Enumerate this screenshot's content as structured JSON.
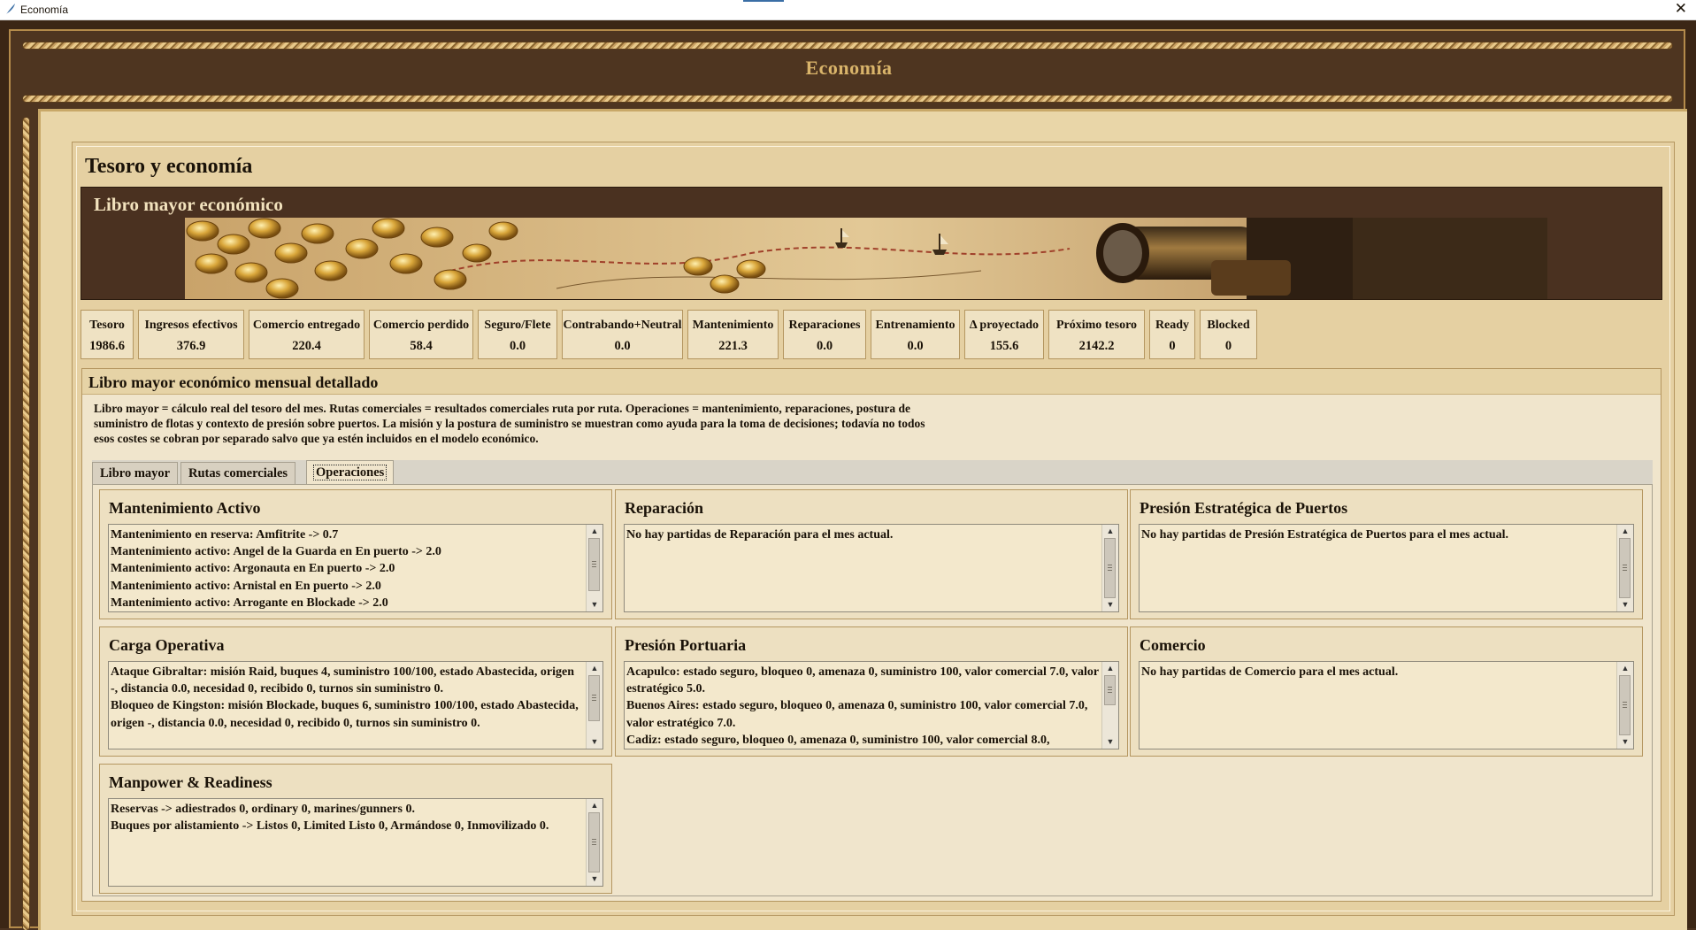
{
  "window": {
    "title": "Economía",
    "close_glyph": "✕"
  },
  "header": {
    "title": "Economía"
  },
  "section": {
    "title": "Tesoro y economía"
  },
  "banner": {
    "title": "Libro mayor económico"
  },
  "stats": [
    {
      "label": "Tesoro",
      "value": "1986.6"
    },
    {
      "label": "Ingresos efectivos",
      "value": "376.9"
    },
    {
      "label": "Comercio entregado",
      "value": "220.4"
    },
    {
      "label": "Comercio perdido",
      "value": "58.4"
    },
    {
      "label": "Seguro/Flete",
      "value": "0.0"
    },
    {
      "label": "Contrabando+Neutral",
      "value": "0.0"
    },
    {
      "label": "Mantenimiento",
      "value": "221.3"
    },
    {
      "label": "Reparaciones",
      "value": "0.0"
    },
    {
      "label": "Entrenamiento",
      "value": "0.0"
    },
    {
      "label": "Δ proyectado",
      "value": "155.6"
    },
    {
      "label": "Próximo tesoro",
      "value": "2142.2"
    },
    {
      "label": "Ready",
      "value": "0"
    },
    {
      "label": "Blocked",
      "value": "0"
    }
  ],
  "ledger": {
    "title": "Libro mayor económico mensual detallado",
    "description": [
      "Libro mayor = cálculo real del tesoro del mes. Rutas comerciales = resultados comerciales ruta por ruta. Operaciones = mantenimiento, reparaciones, postura de",
      "suministro de flotas y contexto de presión sobre puertos. La misión y la postura de suministro se muestran como ayuda para la toma de decisiones; todavía no todos",
      "esos costes se cobran por separado salvo que ya estén incluidos en el modelo económico."
    ]
  },
  "tabs": [
    {
      "label": "Libro mayor",
      "active": false
    },
    {
      "label": "Rutas comerciales",
      "active": false
    },
    {
      "label": "Operaciones",
      "active": true
    }
  ],
  "cards": {
    "mantenimiento": {
      "title": "Mantenimiento Activo",
      "lines": [
        "Mantenimiento en reserva: Amfitrite -> 0.7",
        "Mantenimiento activo: Angel de la Guarda en En puerto -> 2.0",
        "Mantenimiento activo: Argonauta en En puerto -> 2.0",
        "Mantenimiento activo: Arnistal en En puerto -> 2.0",
        "Mantenimiento activo: Arrogante en Blockade -> 2.0"
      ]
    },
    "reparacion": {
      "title": "Reparación",
      "lines": [
        "No hay partidas de Reparación para el mes actual."
      ]
    },
    "presion_estrategica": {
      "title": "Presión Estratégica de Puertos",
      "lines": [
        "No hay partidas de Presión Estratégica de Puertos para el mes actual."
      ]
    },
    "carga": {
      "title": "Carga Operativa",
      "lines": [
        "Ataque Gibraltar: misión Raid, buques 4, suministro 100/100, estado Abastecida, origen -, distancia 0.0, necesidad 0, recibido 0, turnos sin suministro 0.",
        "Bloqueo de Kingston: misión Blockade, buques 6, suministro 100/100, estado Abastecida, origen -, distancia 0.0, necesidad 0, recibido 0, turnos sin suministro 0."
      ]
    },
    "presion_portuaria": {
      "title": "Presión Portuaria",
      "lines": [
        "Acapulco: estado seguro, bloqueo 0, amenaza 0, suministro 100, valor comercial 7.0, valor estratégico 5.0.",
        "Buenos Aires: estado seguro, bloqueo 0, amenaza 0, suministro 100, valor comercial 7.0, valor estratégico 7.0.",
        "Cadiz: estado seguro, bloqueo 0, amenaza 0, suministro 100, valor comercial 8.0,"
      ]
    },
    "comercio": {
      "title": "Comercio",
      "lines": [
        "No hay partidas de Comercio para el mes actual."
      ]
    },
    "manpower": {
      "title": "Manpower & Readiness",
      "lines": [
        "Reservas -> adiestrados 0, ordinary 0, marines/gunners 0.",
        "Buques por alistamiento -> Listos 0, Limited Listo 0, Armándose 0, Inmovilizado 0."
      ]
    }
  },
  "scroll_arrows": {
    "up": "▲",
    "down": "▼"
  }
}
